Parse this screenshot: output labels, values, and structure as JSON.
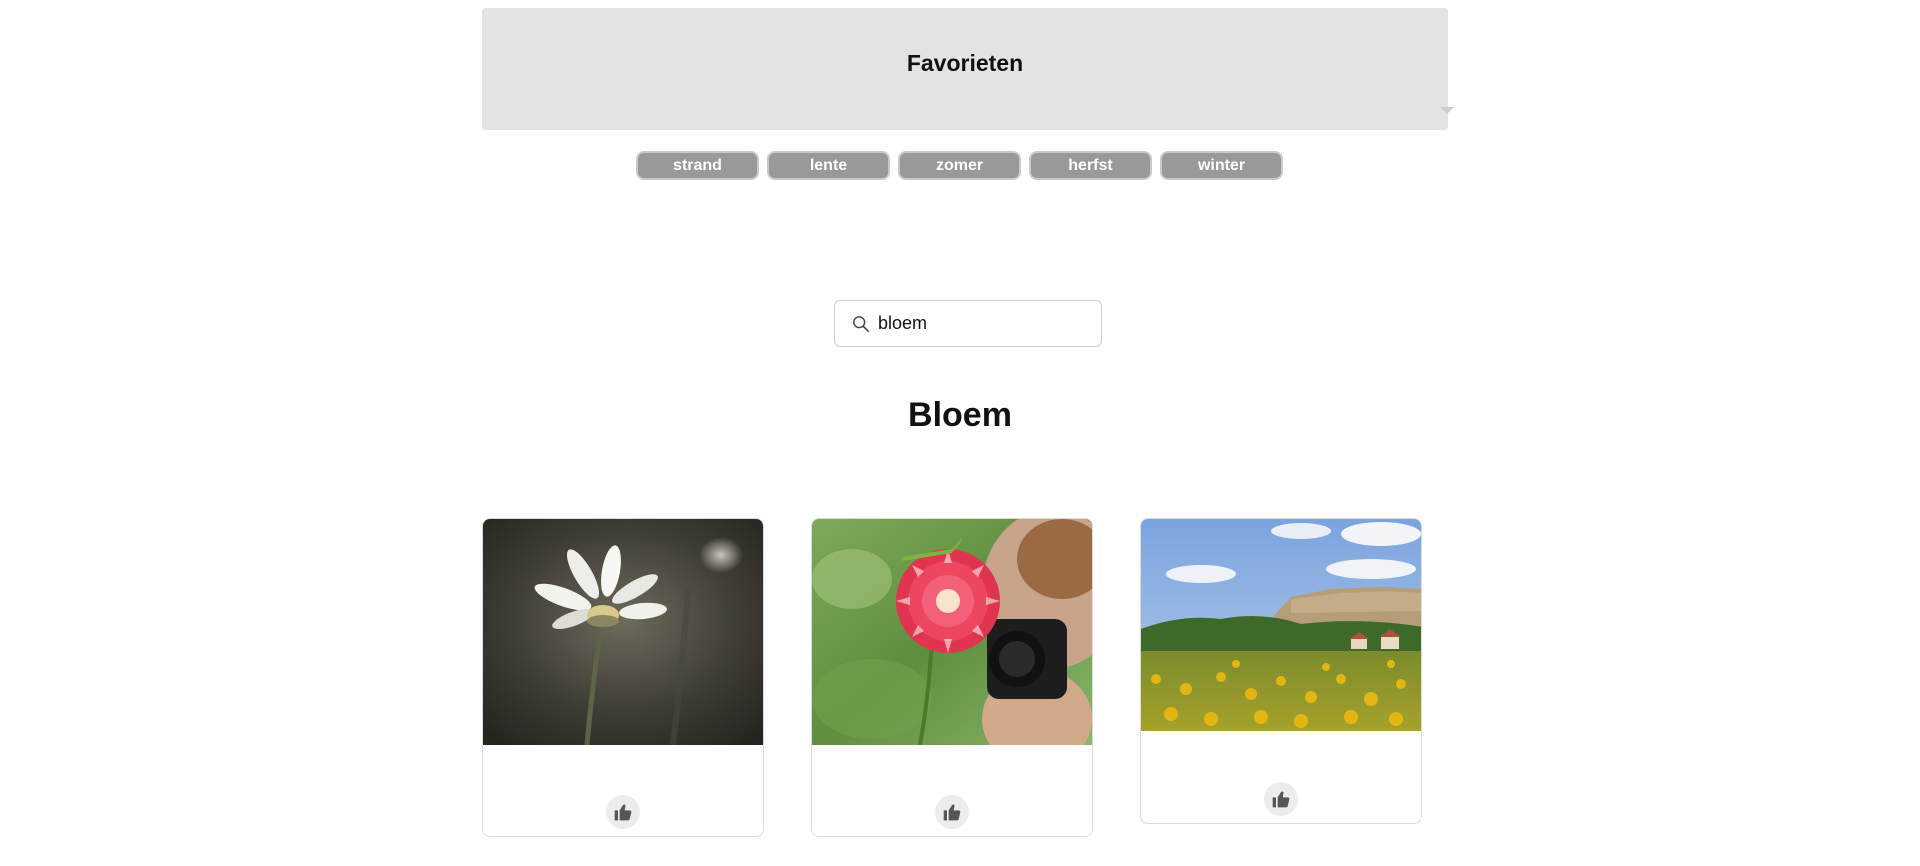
{
  "favorites": {
    "title": "Favorieten"
  },
  "tags": [
    "strand",
    "lente",
    "zomer",
    "herfst",
    "winter"
  ],
  "search": {
    "value": "bloem",
    "icon": "search-icon"
  },
  "section": {
    "title": "Bloem"
  },
  "cards": [
    {
      "subject": "white daisy",
      "like_icon": "thumbs-up-icon"
    },
    {
      "subject": "red dahlia with photographer",
      "like_icon": "thumbs-up-icon"
    },
    {
      "subject": "sunflower field landscape",
      "like_icon": "thumbs-up-icon"
    }
  ],
  "colors": {
    "panel_bg": "#e3e3e3",
    "tag_bg": "#999999",
    "tag_border": "#c9c9c9",
    "like_bg": "#ececec"
  }
}
